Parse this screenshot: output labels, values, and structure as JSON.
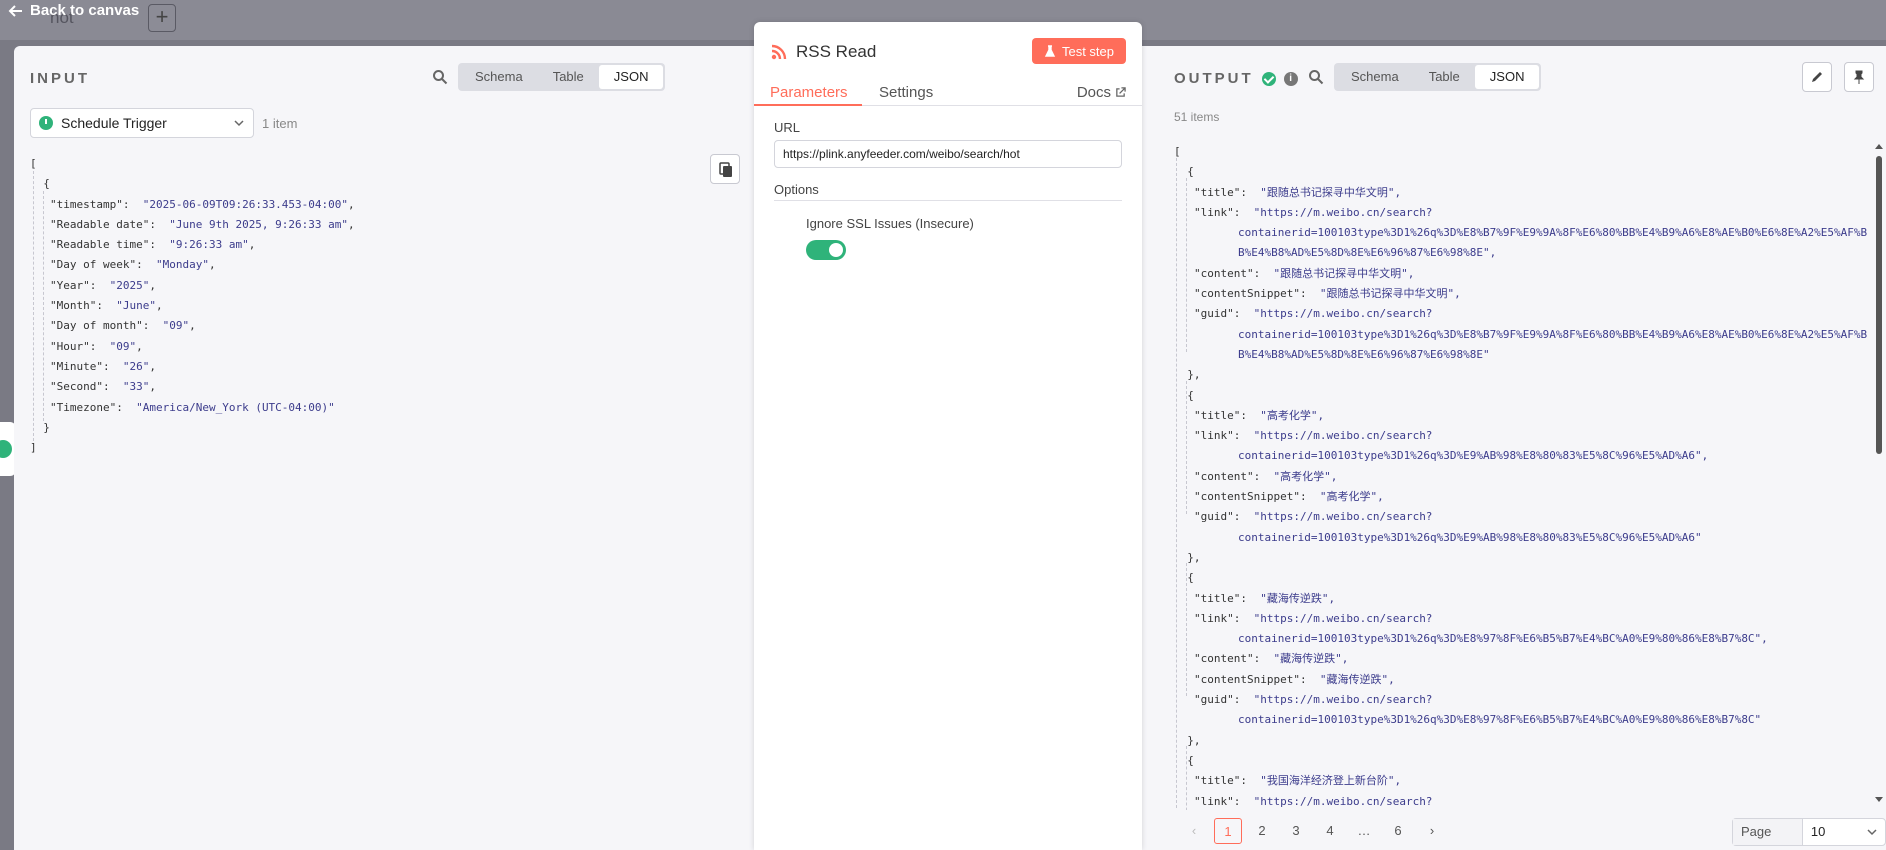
{
  "canvas": {
    "back_label": "Back to canvas",
    "workflow_name": "hot",
    "add_label": "+"
  },
  "input": {
    "label": "INPUT",
    "views": [
      "Schema",
      "Table",
      "JSON"
    ],
    "active_view": "JSON",
    "node_select": "Schedule Trigger",
    "item_count": "1 item",
    "json_lines": [
      {
        "t": "["
      },
      {
        "t": "  {"
      },
      {
        "k": "\"timestamp\"",
        "v": "\"2025-06-09T09:26:33.453-04:00\""
      },
      {
        "k": "\"Readable date\"",
        "v": "\"June 9th 2025, 9:26:33 am\""
      },
      {
        "k": "\"Readable time\"",
        "v": "\"9:26:33 am\""
      },
      {
        "k": "\"Day of week\"",
        "v": "\"Monday\""
      },
      {
        "k": "\"Year\"",
        "v": "\"2025\""
      },
      {
        "k": "\"Month\"",
        "v": "\"June\""
      },
      {
        "k": "\"Day of month\"",
        "v": "\"09\""
      },
      {
        "k": "\"Hour\"",
        "v": "\"09\""
      },
      {
        "k": "\"Minute\"",
        "v": "\"26\""
      },
      {
        "k": "\"Second\"",
        "v": "\"33\""
      },
      {
        "k": "\"Timezone\"",
        "v": "\"America/New_York (UTC-04:00)\"",
        "last": true
      },
      {
        "t": "  }"
      },
      {
        "t": "]"
      }
    ]
  },
  "node": {
    "title": "RSS Read",
    "test_label": "Test step",
    "tabs": [
      "Parameters",
      "Settings"
    ],
    "docs_label": "Docs",
    "url_label": "URL",
    "url_value": "https://plink.anyfeeder.com/weibo/search/hot",
    "options_label": "Options",
    "ssl_label": "Ignore SSL Issues (Insecure)"
  },
  "output": {
    "label": "OUTPUT",
    "views": [
      "Schema",
      "Table",
      "JSON"
    ],
    "active_view": "JSON",
    "items_count": "51 items",
    "json_lines": [
      {
        "t": "["
      },
      {
        "t": "  {"
      },
      {
        "k": "\"title\"",
        "v": "\"跟随总书记探寻中华文明\","
      },
      {
        "k": "\"link\"",
        "v": "\"https://m.weibo.cn/search?"
      },
      {
        "c": "containerid=100103type%3D1%26q%3D%E8%B7%9F%E9%9A%8F%E6%80%BB%E4%B9%A6%E8%AE%B0%E6%8E%A2%E5%AF%B"
      },
      {
        "c": "B%E4%B8%AD%E5%8D%8E%E6%96%87%E6%98%8E\","
      },
      {
        "k": "\"content\"",
        "v": "\"跟随总书记探寻中华文明\","
      },
      {
        "k": "\"contentSnippet\"",
        "v": "\"跟随总书记探寻中华文明\","
      },
      {
        "k": "\"guid\"",
        "v": "\"https://m.weibo.cn/search?"
      },
      {
        "c": "containerid=100103type%3D1%26q%3D%E8%B7%9F%E9%9A%8F%E6%80%BB%E4%B9%A6%E8%AE%B0%E6%8E%A2%E5%AF%B"
      },
      {
        "c": "B%E4%B8%AD%E5%8D%8E%E6%96%87%E6%98%8E\""
      },
      {
        "t": "  },"
      },
      {
        "t": "  {"
      },
      {
        "k": "\"title\"",
        "v": "\"高考化学\","
      },
      {
        "k": "\"link\"",
        "v": "\"https://m.weibo.cn/search?"
      },
      {
        "c": "containerid=100103type%3D1%26q%3D%E9%AB%98%E8%80%83%E5%8C%96%E5%AD%A6\","
      },
      {
        "k": "\"content\"",
        "v": "\"高考化学\","
      },
      {
        "k": "\"contentSnippet\"",
        "v": "\"高考化学\","
      },
      {
        "k": "\"guid\"",
        "v": "\"https://m.weibo.cn/search?"
      },
      {
        "c": "containerid=100103type%3D1%26q%3D%E9%AB%98%E8%80%83%E5%8C%96%E5%AD%A6\""
      },
      {
        "t": "  },"
      },
      {
        "t": "  {"
      },
      {
        "k": "\"title\"",
        "v": "\"藏海传逆跌\","
      },
      {
        "k": "\"link\"",
        "v": "\"https://m.weibo.cn/search?"
      },
      {
        "c": "containerid=100103type%3D1%26q%3D%E8%97%8F%E6%B5%B7%E4%BC%A0%E9%80%86%E8%B7%8C\","
      },
      {
        "k": "\"content\"",
        "v": "\"藏海传逆跌\","
      },
      {
        "k": "\"contentSnippet\"",
        "v": "\"藏海传逆跌\","
      },
      {
        "k": "\"guid\"",
        "v": "\"https://m.weibo.cn/search?"
      },
      {
        "c": "containerid=100103type%3D1%26q%3D%E8%97%8F%E6%B5%B7%E4%BC%A0%E9%80%86%E8%B7%8C\""
      },
      {
        "t": "  },"
      },
      {
        "t": "  {"
      },
      {
        "k": "\"title\"",
        "v": "\"我国海洋经济登上新台阶\","
      },
      {
        "k": "\"link\"",
        "v": "\"https://m.weibo.cn/search?"
      }
    ]
  },
  "pagination": {
    "prev": "‹",
    "pages": [
      "1",
      "2",
      "3",
      "4",
      "…",
      "6"
    ],
    "active": "1",
    "next": "›",
    "page_size_label": "Page Size",
    "page_size_value": "10"
  },
  "colors": {
    "accent": "#ff6d5a",
    "success": "#2fb37a"
  }
}
